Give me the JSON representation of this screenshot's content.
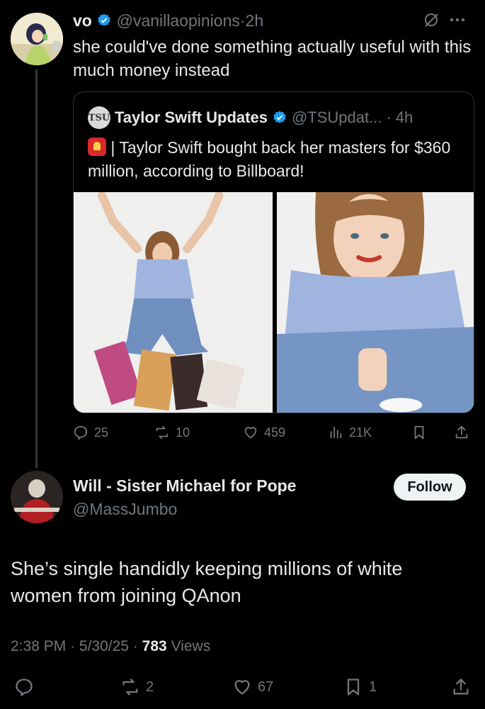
{
  "tweet1": {
    "name": "vo",
    "handle": "@vanillaopinions",
    "time": "2h",
    "text": "she could've done something actually useful with this much money instead",
    "stats": {
      "replies": "25",
      "reposts": "10",
      "likes": "459",
      "views": "21K"
    }
  },
  "quote": {
    "logo_text": "TSU",
    "name": "Taylor Swift Updates",
    "handle": "@TSUpdat...",
    "time": "4h",
    "text": "| Taylor Swift bought back her masters for $360 million, according to Billboard!"
  },
  "tweet2": {
    "name": "Will - Sister Michael for Pope",
    "handle": "@MassJumbo",
    "follow_label": "Follow",
    "text": "She’s single handidly keeping millions of white women from joining QAnon",
    "time": "2:38 PM",
    "date": "5/30/25",
    "views_count": "783",
    "views_label": "Views",
    "stats": {
      "reposts": "2",
      "likes": "67",
      "bookmarks": "1"
    }
  },
  "separator": "·",
  "colors": {
    "background": "#000000",
    "verified": "#1d9bf0",
    "text": "#e7e9ea",
    "muted": "#71767b"
  }
}
